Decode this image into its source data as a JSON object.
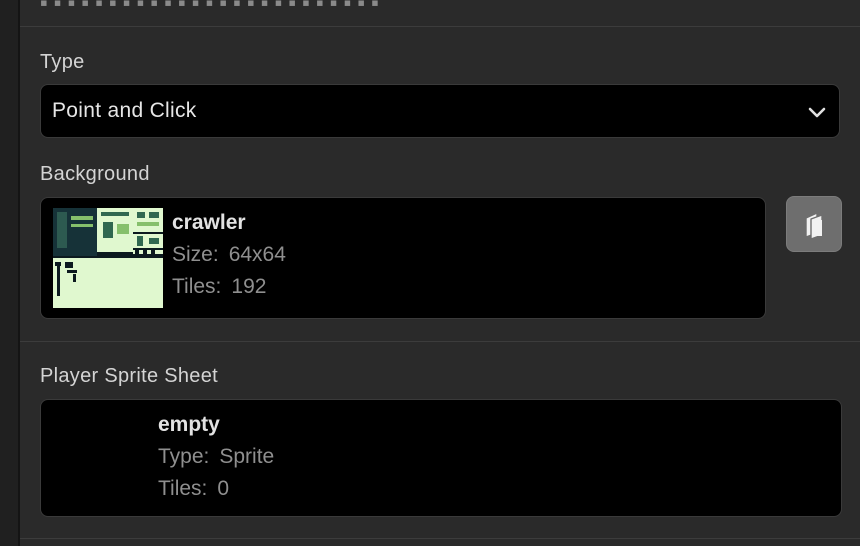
{
  "type_field": {
    "label": "Type",
    "value": "Point and Click"
  },
  "background_field": {
    "label": "Background",
    "name": "crawler",
    "size_label": "Size:",
    "size_value": "64x64",
    "tiles_label": "Tiles:",
    "tiles_value": "192"
  },
  "player_sprite_field": {
    "label": "Player Sprite Sheet",
    "name": "empty",
    "type_label": "Type:",
    "type_value": "Sprite",
    "tiles_label": "Tiles:",
    "tiles_value": "0"
  },
  "icons": {
    "type_dropdown": "chevron-down-icon",
    "background_action": "layers-icon"
  },
  "colors": {
    "panel_bg": "#2a2a2a",
    "field_bg": "#000000",
    "button_bg": "#6e6e6e",
    "thumb_light": "#e0f8cf",
    "thumb_dark": "#0c1a1f"
  }
}
